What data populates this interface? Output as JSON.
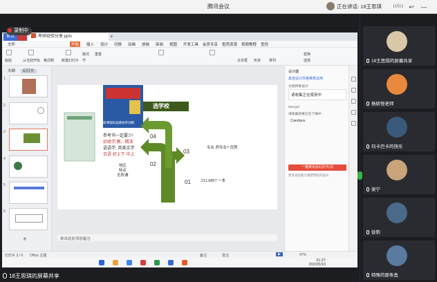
{
  "window": {
    "title": "腾讯会议",
    "speaking": "正在讲话: 18王思琪",
    "recording": "录制中"
  },
  "wps": {
    "tabs": {
      "home": "首页",
      "t2": "",
      "doc": "考研经验分享.pptx"
    },
    "menu": [
      "文件",
      "开始",
      "插入",
      "设计",
      "切换",
      "动画",
      "放映",
      "审阅",
      "视图",
      "开发工具",
      "会员专享",
      "稻壳资源",
      "视频教程",
      "查找"
    ],
    "ribbon": [
      "从当前开始",
      "新建幻灯片",
      "版式",
      "节",
      "重置",
      "粘贴",
      "格式刷",
      "文本框",
      "形状",
      "排列",
      "替换",
      "选择"
    ],
    "left_panel": {
      "tab_outline": "大纲",
      "tab_slides": "幻灯片",
      "slide_numbers": [
        "1",
        "2",
        "3",
        "4",
        "5",
        "6"
      ]
    },
    "slide": {
      "title": "选学校",
      "cover_caption": "新课程标准德语单词精",
      "text_block_lines": [
        "参考书一定要少!",
        "初级学,教、精读",
        "语语学, 英美文学",
        "日语 初上下 中上"
      ],
      "left_items": [
        "地区",
        "特点",
        "无所谓"
      ],
      "arrow_labels": [
        "04",
        "03",
        "02",
        "01"
      ],
      "right_items": [
        "专业 师专业? 优势",
        "211,985? 一本"
      ]
    },
    "notes_placeholder": "单击此处添加备注",
    "right_panel": {
      "title": "设计器",
      "link": "其他设计风格推荐试用",
      "section": "文档转换设计",
      "input_1": "请收集正在使用中",
      "sub_2": "Mengal",
      "sub_3": "请收集结果正在下载中",
      "input_2": "Candara",
      "button": "一键美化此幻灯片(2)",
      "note": "更多美化能力请使用稻壳会员"
    },
    "statusbar": {
      "slide_info": "幻灯片 3 / 6",
      "theme": "Office 主题",
      "notes_btn": "备注",
      "comments_btn": "批注",
      "zoom": "47%"
    },
    "taskbar": {
      "time": "21:27",
      "date": "2022/5/10"
    }
  },
  "share_label": "18王思琪的屏幕共享",
  "participants": [
    {
      "name": "18王思琪的屏幕共享",
      "avatar_color": "#d9c7a8"
    },
    {
      "name": "杨娇悦老师",
      "avatar_color": "#e8893d"
    },
    {
      "name": "玛卡巴卡的快乐",
      "avatar_color": "#3a5a7a"
    },
    {
      "name": "梁宁",
      "avatar_color": "#c9a37a"
    },
    {
      "name": "徐莉",
      "avatar_color": "#4a6a8a"
    },
    {
      "name": "特殊的那条鱼",
      "avatar_color": "#5a7aa0"
    }
  ],
  "colors": {
    "slide_arrow": "#5d8a26",
    "slide_title_bg": "#3d5a1c",
    "accent_red": "#e64c3c"
  }
}
